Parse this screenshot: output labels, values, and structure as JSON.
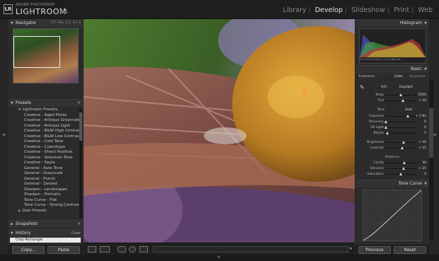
{
  "app": {
    "badge": "LR",
    "brand_small": "ADOBE PHOTOSHOP",
    "brand": "LIGHTROOM",
    "version": "1.4"
  },
  "modules": [
    {
      "label": "Library",
      "active": false
    },
    {
      "label": "Develop",
      "active": true
    },
    {
      "label": "Slideshow",
      "active": false
    },
    {
      "label": "Print",
      "active": false
    },
    {
      "label": "Web",
      "active": false
    }
  ],
  "navigator": {
    "title": "Navigator",
    "options": "FIT  FILL  1:1  3:1  ⁑"
  },
  "presets": {
    "title": "Presets",
    "add": "+",
    "folders": [
      {
        "name": "Lightroom Presets",
        "open": true,
        "items": [
          "Creative - Aged Photo",
          "Creative - Antique Grayscale",
          "Creative - Antique Light",
          "Creative - B&W High Contrast",
          "Creative - B&W Low Contrast",
          "Creative - Cold Tone",
          "Creative - Cyanotype",
          "Creative - Direct Positive",
          "Creative - Selenium Tone",
          "Creative - Sepia",
          "General - Auto Tone",
          "General - Grayscale",
          "General - Punch",
          "General - Zeroed",
          "Sharpen - Landscapes",
          "Sharpen - Portraits",
          "Tone Curve - Flat",
          "Tone Curve - Strong Contrast"
        ]
      },
      {
        "name": "User Presets",
        "open": false,
        "items": []
      }
    ]
  },
  "snapshots": {
    "title": "Snapshots",
    "add": "+"
  },
  "history": {
    "title": "History",
    "action": "Clear",
    "first": "Crop Rectangle"
  },
  "left_buttons": {
    "copy": "Copy...",
    "paste": "Paste"
  },
  "histogram": {
    "title": "Histogram",
    "info": "ISO 100    55 mm    f / 5.6    1/80 sec"
  },
  "basic": {
    "title": "Basic",
    "treatment_label": "Treatment :",
    "color": "Color",
    "grayscale": "Grayscale",
    "wb_label": "WB :",
    "wb_value": "Daylight",
    "tone_label": "Tone",
    "auto": "Auto",
    "presence_label": "Presence",
    "sliders": [
      {
        "label": "Temp",
        "value": "5500",
        "pos": 0.5,
        "group": "wb"
      },
      {
        "label": "Tint",
        "value": "+ 10",
        "pos": 0.56,
        "group": "wb"
      },
      {
        "label": "Exposure",
        "value": "+ 1.83",
        "pos": 0.72,
        "group": "tone"
      },
      {
        "label": "Recovery",
        "value": "0",
        "pos": 0.02,
        "group": "tone"
      },
      {
        "label": "Fill Light",
        "value": "0",
        "pos": 0.02,
        "group": "tone"
      },
      {
        "label": "Blacks",
        "value": "5",
        "pos": 0.06,
        "group": "tone"
      },
      {
        "label": "Brightness",
        "value": "+ 50",
        "pos": 0.6,
        "group": "tone2"
      },
      {
        "label": "Contrast",
        "value": "+ 25",
        "pos": 0.55,
        "group": "tone2"
      },
      {
        "label": "Clarity",
        "value": "30",
        "pos": 0.62,
        "group": "presence"
      },
      {
        "label": "Vibrance",
        "value": "+ 25",
        "pos": 0.6,
        "group": "presence"
      },
      {
        "label": "Saturation",
        "value": "0",
        "pos": 0.5,
        "group": "presence"
      }
    ]
  },
  "tonecurve": {
    "title": "Tone Curve"
  },
  "right_buttons": {
    "previous": "Previous",
    "reset": "Reset"
  },
  "colors": {
    "accent": "#e6e6e6",
    "panel": "#2b2b2b",
    "header": "#323232",
    "background": "#262626"
  }
}
